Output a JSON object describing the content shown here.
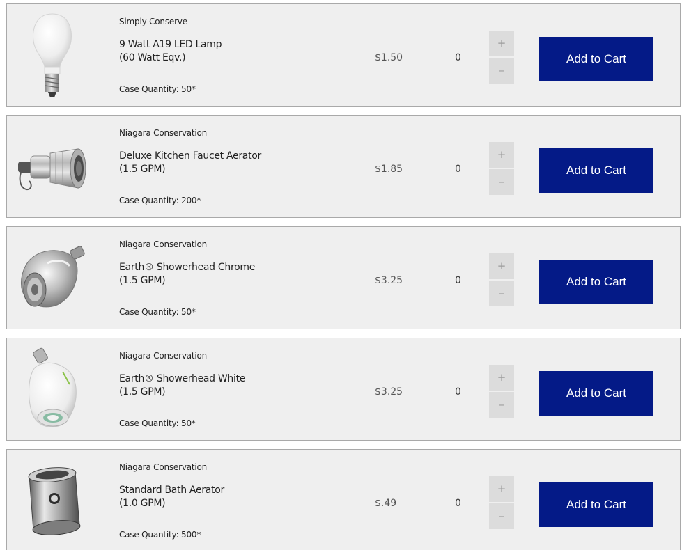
{
  "colors": {
    "card_bg": "#efefef",
    "border": "#a9a9a9",
    "add_button": "#041a87",
    "add_button_text": "#ffffff",
    "stepper_bg": "#dcdcdc"
  },
  "products": [
    {
      "brand": "Simply Conserve",
      "name_line1": "9 Watt A19 LED Lamp",
      "name_line2": "(60 Watt Eqv.)",
      "case_quantity": "Case Quantity: 50*",
      "price": "$1.50",
      "quantity": "0",
      "plus": "+",
      "minus": "–",
      "add_to_cart": "Add to Cart",
      "image_icon": "led-bulb-icon"
    },
    {
      "brand": "Niagara Conservation",
      "name_line1": "Deluxe Kitchen Faucet Aerator",
      "name_line2": "(1.5 GPM)",
      "case_quantity": "Case Quantity: 200*",
      "price": "$1.85",
      "quantity": "0",
      "plus": "+",
      "minus": "–",
      "add_to_cart": "Add to Cart",
      "image_icon": "faucet-aerator-icon"
    },
    {
      "brand": "Niagara Conservation",
      "name_line1": "Earth® Showerhead Chrome",
      "name_line2": "(1.5 GPM)",
      "case_quantity": "Case Quantity: 50*",
      "price": "$3.25",
      "quantity": "0",
      "plus": "+",
      "minus": "–",
      "add_to_cart": "Add to Cart",
      "image_icon": "chrome-showerhead-icon"
    },
    {
      "brand": "Niagara Conservation",
      "name_line1": "Earth® Showerhead White",
      "name_line2": "(1.5 GPM)",
      "case_quantity": "Case Quantity: 50*",
      "price": "$3.25",
      "quantity": "0",
      "plus": "+",
      "minus": "–",
      "add_to_cart": "Add to Cart",
      "image_icon": "white-showerhead-icon"
    },
    {
      "brand": "Niagara Conservation",
      "name_line1": "Standard Bath Aerator",
      "name_line2": "(1.0 GPM)",
      "case_quantity": "Case Quantity: 500*",
      "price": "$.49",
      "quantity": "0",
      "plus": "+",
      "minus": "–",
      "add_to_cart": "Add to Cart",
      "image_icon": "bath-aerator-icon"
    }
  ]
}
